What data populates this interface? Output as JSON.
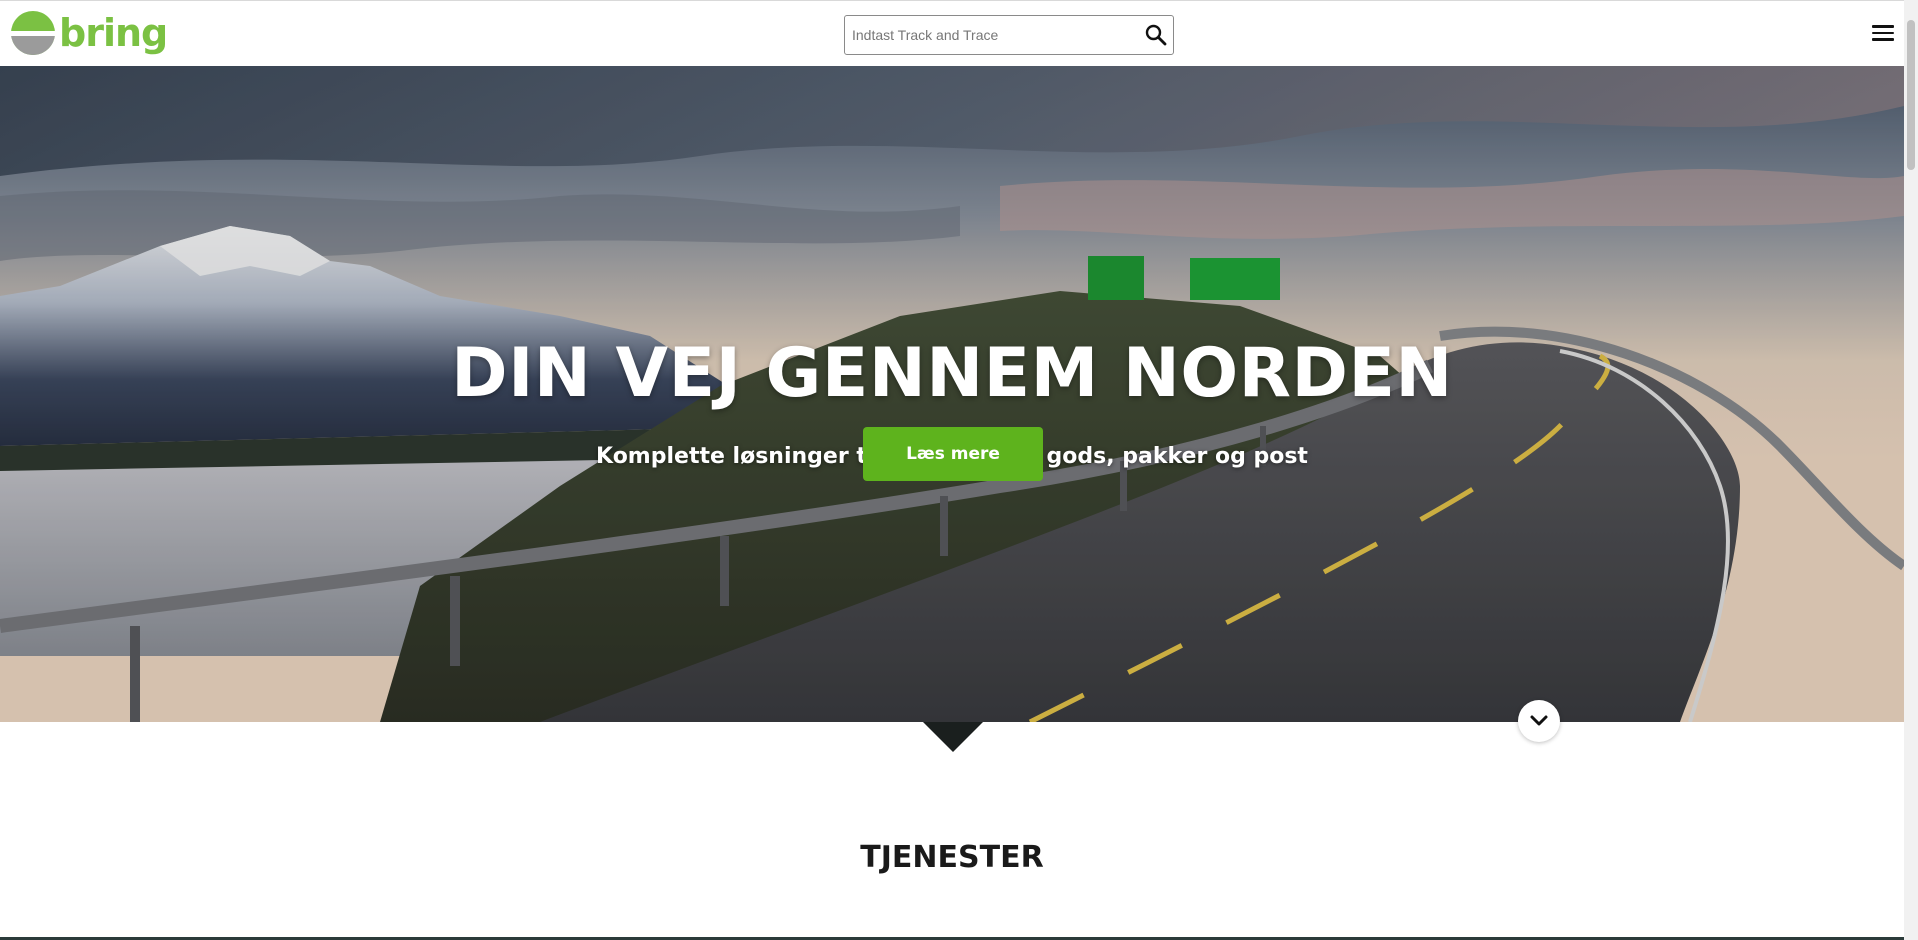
{
  "header": {
    "logo_text": "bring",
    "search": {
      "placeholder": "Indtast Track and Trace",
      "value": ""
    },
    "icons": {
      "search": "search-icon",
      "menu": "hamburger-menu-icon"
    }
  },
  "hero": {
    "title": "DIN VEJ GENNEM NORDEN",
    "subtitle": "Komplette løsninger til transport af gods, pakker og post",
    "cta_label": "Læs mere",
    "cta_color": "#5eb31d",
    "scroll_icon": "chevron-down-icon"
  },
  "section": {
    "title": "TJENESTER"
  },
  "colors": {
    "brand_green": "#7bc143",
    "logo_gray": "#8a8a8a"
  }
}
